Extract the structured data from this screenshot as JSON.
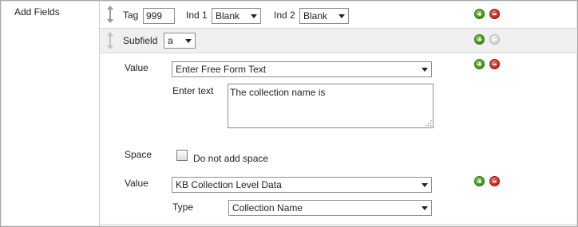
{
  "section_label": "Add Fields",
  "tag_row": {
    "tag_label": "Tag",
    "tag_value": "999",
    "ind1_label": "Ind 1",
    "ind1_value": "Blank",
    "ind2_label": "Ind 2",
    "ind2_value": "Blank"
  },
  "subfield_row": {
    "label": "Subfield",
    "value": "a"
  },
  "value_block_1": {
    "value_label": "Value",
    "value_select": "Enter Free Form Text",
    "enter_text_label": "Enter text",
    "enter_text_value": "The collection name is"
  },
  "space_row": {
    "label": "Space",
    "checkbox_label": "Do not add space",
    "checked": false
  },
  "value_block_2": {
    "value_label": "Value",
    "value_select": "KB Collection Level Data",
    "type_label": "Type",
    "type_select": "Collection Name"
  },
  "colors": {
    "add": "#3f8f1c",
    "remove": "#c0221a",
    "disabled": "#d2d2d2",
    "subfield_bg": "#f0f0f0"
  }
}
